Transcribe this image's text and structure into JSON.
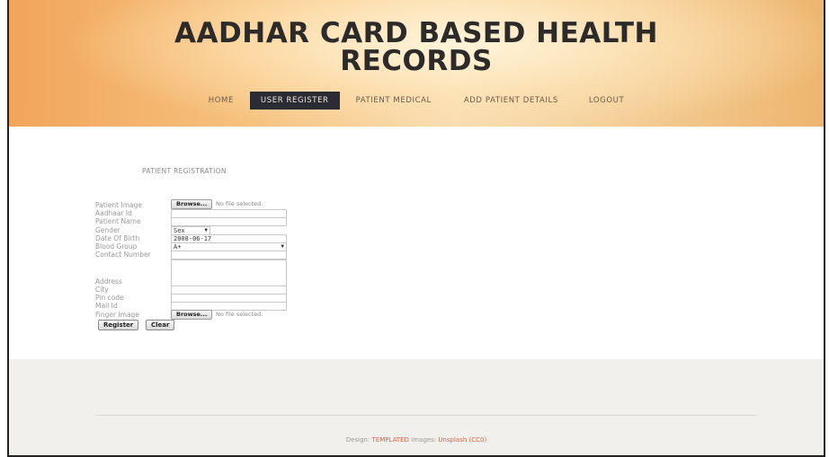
{
  "header": {
    "title_line1": "AADHAR CARD BASED HEALTH",
    "title_line2": "RECORDS",
    "nav": [
      {
        "label": "HOME"
      },
      {
        "label": "USER REGISTER",
        "active": true
      },
      {
        "label": "PATIENT MEDICAL"
      },
      {
        "label": "ADD PATIENT DETAILS"
      },
      {
        "label": "LOGOUT"
      }
    ]
  },
  "form": {
    "section_title": "PATIENT REGISTRATION",
    "labels": {
      "patient_image": "Patient Image",
      "aadhaar_id": "Aadhaar Id",
      "patient_name": "Patient Name",
      "gender": "Gender",
      "dob": "Date Of Birth",
      "blood_group": "Blood Group",
      "contact": "Contact Number",
      "address": "Address",
      "city": "City",
      "pin": "Pin code",
      "mail": "Mail Id",
      "finger": "Finger Image"
    },
    "browse_label": "Browse...",
    "no_file_text": "No file selected.",
    "gender_value": "Sex",
    "dob_value": "2008-06-17",
    "blood_group_value": "A+",
    "register_label": "Register",
    "clear_label": "Clear"
  },
  "footer": {
    "design_label": "Design:",
    "design_link": "TEMPLATED",
    "images_label": "Images:",
    "images_link": "Unsplash (CC0)"
  },
  "colors": {
    "active_nav_bg": "#2b2b33",
    "footer_link": "#e25d3e",
    "footer_bg": "#f2f0ec"
  }
}
